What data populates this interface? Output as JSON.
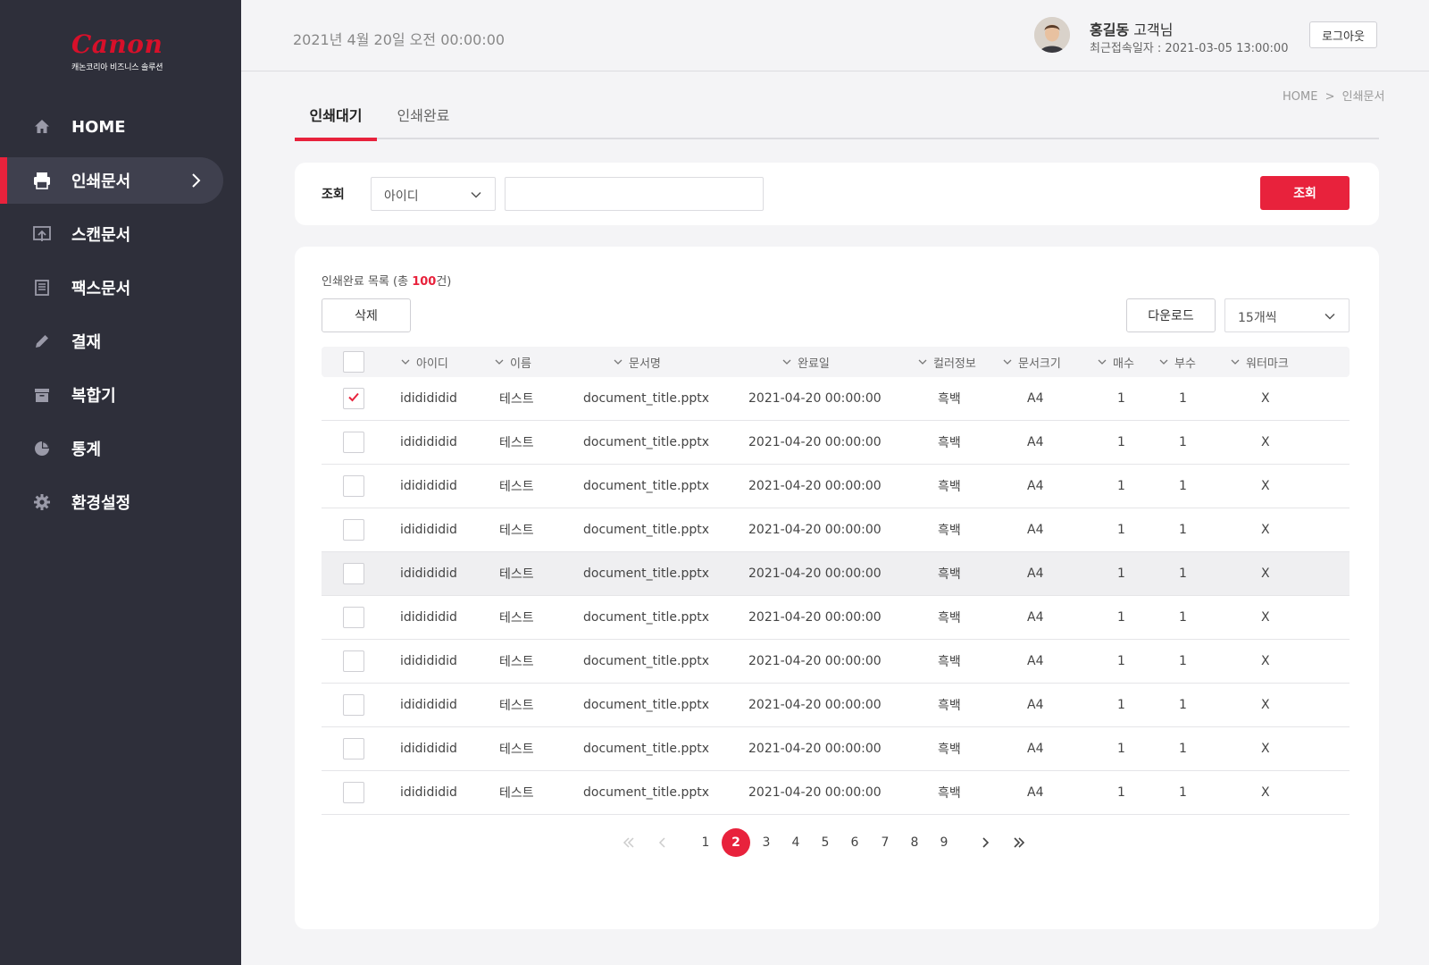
{
  "brand": {
    "logo_text": "Canon",
    "subtitle": "캐논코리아 비즈니스 솔루션",
    "accent_color": "#e8223c",
    "sidebar_color": "#2e2f3a"
  },
  "sidebar": {
    "items": [
      {
        "label": "HOME",
        "icon": "home-icon"
      },
      {
        "label": "인쇄문서",
        "icon": "printer-icon",
        "active": true
      },
      {
        "label": "스캔문서",
        "icon": "scan-upload-icon"
      },
      {
        "label": "팩스문서",
        "icon": "fax-document-icon"
      },
      {
        "label": "결재",
        "icon": "pencil-icon"
      },
      {
        "label": "복합기",
        "icon": "archive-box-icon"
      },
      {
        "label": "통계",
        "icon": "pie-chart-icon"
      },
      {
        "label": "환경설정",
        "icon": "gear-icon"
      }
    ]
  },
  "header": {
    "datetime": "2021년 4월 20일 오전 00:00:00",
    "user_name": "홍길동",
    "user_suffix": " 고객님",
    "last_login": "최근접속일자 : 2021-03-05 13:00:00",
    "logout_label": "로그아웃"
  },
  "breadcrumb": {
    "home": "HOME",
    "separator": ">",
    "current": "인쇄문서"
  },
  "tabs": [
    {
      "label": "인쇄대기",
      "active": true
    },
    {
      "label": "인쇄완료",
      "active": false
    }
  ],
  "search": {
    "label": "조회",
    "select_value": "아이디",
    "input_value": "",
    "button_label": "조회"
  },
  "list": {
    "title_prefix": "인쇄완료 목록 (총 ",
    "total": "100",
    "title_suffix": "건)",
    "delete_label": "삭제",
    "download_label": "다운로드",
    "page_size": "15개씩"
  },
  "table": {
    "columns": [
      "아이디",
      "이름",
      "문서명",
      "완료일",
      "컬러정보",
      "문서크기",
      "매수",
      "부수",
      "워터마크"
    ],
    "rows": [
      {
        "checked": true,
        "id": "ididididid",
        "name": "테스트",
        "doc": "document_title.pptx",
        "date": "2021-04-20 00:00:00",
        "color": "흑백",
        "size": "A4",
        "sheets": "1",
        "copies": "1",
        "watermark": "X"
      },
      {
        "checked": false,
        "id": "ididididid",
        "name": "테스트",
        "doc": "document_title.pptx",
        "date": "2021-04-20 00:00:00",
        "color": "흑백",
        "size": "A4",
        "sheets": "1",
        "copies": "1",
        "watermark": "X"
      },
      {
        "checked": false,
        "id": "ididididid",
        "name": "테스트",
        "doc": "document_title.pptx",
        "date": "2021-04-20 00:00:00",
        "color": "흑백",
        "size": "A4",
        "sheets": "1",
        "copies": "1",
        "watermark": "X"
      },
      {
        "checked": false,
        "id": "ididididid",
        "name": "테스트",
        "doc": "document_title.pptx",
        "date": "2021-04-20 00:00:00",
        "color": "흑백",
        "size": "A4",
        "sheets": "1",
        "copies": "1",
        "watermark": "X"
      },
      {
        "checked": false,
        "id": "ididididid",
        "name": "테스트",
        "doc": "document_title.pptx",
        "date": "2021-04-20 00:00:00",
        "color": "흑백",
        "size": "A4",
        "sheets": "1",
        "copies": "1",
        "watermark": "X",
        "highlighted": true
      },
      {
        "checked": false,
        "id": "ididididid",
        "name": "테스트",
        "doc": "document_title.pptx",
        "date": "2021-04-20 00:00:00",
        "color": "흑백",
        "size": "A4",
        "sheets": "1",
        "copies": "1",
        "watermark": "X"
      },
      {
        "checked": false,
        "id": "ididididid",
        "name": "테스트",
        "doc": "document_title.pptx",
        "date": "2021-04-20 00:00:00",
        "color": "흑백",
        "size": "A4",
        "sheets": "1",
        "copies": "1",
        "watermark": "X"
      },
      {
        "checked": false,
        "id": "ididididid",
        "name": "테스트",
        "doc": "document_title.pptx",
        "date": "2021-04-20 00:00:00",
        "color": "흑백",
        "size": "A4",
        "sheets": "1",
        "copies": "1",
        "watermark": "X"
      },
      {
        "checked": false,
        "id": "ididididid",
        "name": "테스트",
        "doc": "document_title.pptx",
        "date": "2021-04-20 00:00:00",
        "color": "흑백",
        "size": "A4",
        "sheets": "1",
        "copies": "1",
        "watermark": "X"
      },
      {
        "checked": false,
        "id": "ididididid",
        "name": "테스트",
        "doc": "document_title.pptx",
        "date": "2021-04-20 00:00:00",
        "color": "흑백",
        "size": "A4",
        "sheets": "1",
        "copies": "1",
        "watermark": "X"
      }
    ]
  },
  "pagination": {
    "pages": [
      "1",
      "2",
      "3",
      "4",
      "5",
      "6",
      "7",
      "8",
      "9"
    ],
    "current": "2"
  }
}
